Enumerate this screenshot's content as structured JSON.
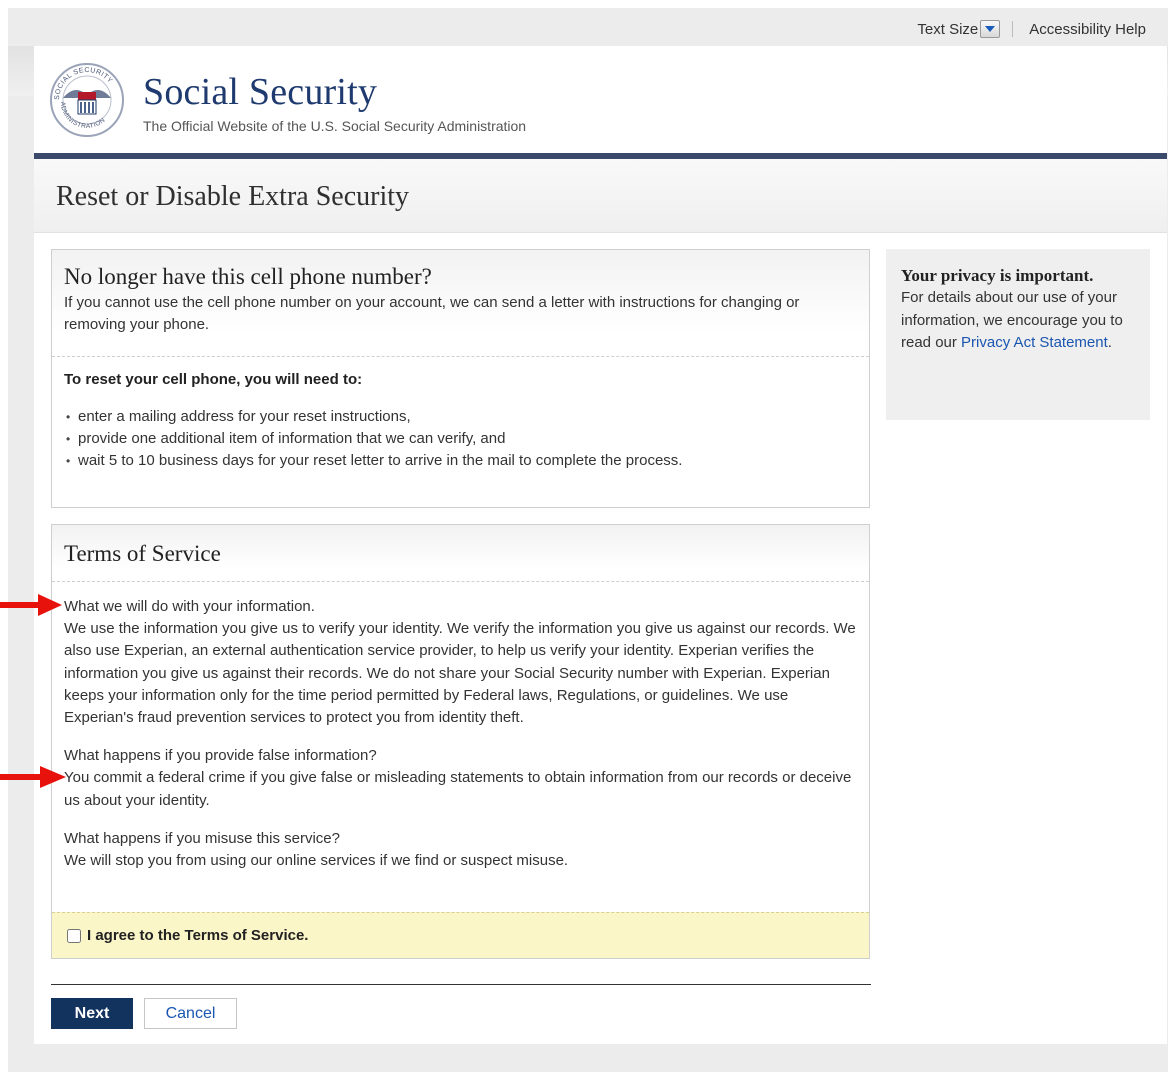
{
  "utility_bar": {
    "text_size_label": "Text Size",
    "accessibility_help": "Accessibility Help"
  },
  "header": {
    "site_name": "Social Security",
    "tagline": "The Official Website of the U.S. Social Security Administration",
    "seal_text": "SOCIAL SECURITY ADMINISTRATION USA"
  },
  "page_title": "Reset or Disable Extra Security",
  "phone_panel": {
    "heading": "No longer have this cell phone number?",
    "intro": "If you cannot use the cell phone number on your account, we can send a letter with instructions for changing or removing your phone.",
    "need_heading": "To reset your cell phone, you will need to:",
    "items": [
      "enter a mailing address for your reset instructions,",
      "provide one additional item of information that we can verify, and",
      "wait 5 to 10 business days for your reset letter to arrive in the mail to complete the process."
    ]
  },
  "terms_panel": {
    "heading": "Terms of Service",
    "sections": [
      {
        "title": "What we will do with your information.",
        "body": "We use the information you give us to verify your identity. We verify the information you give us against our records. We also use Experian, an external authentication service provider, to help us verify your identity. Experian verifies the information you give us against their records. We do not share your Social Security number with Experian. Experian keeps your information only for the time period permitted by Federal laws, Regulations, or guidelines. We use Experian's fraud prevention services to protect you from identity theft."
      },
      {
        "title": "What happens if you provide false information?",
        "body": "You commit a federal crime if you give false or misleading statements to obtain information from our records or deceive us about your identity."
      },
      {
        "title": "What happens if you misuse this service?",
        "body": "We will stop you from using our online services if we find or suspect misuse."
      }
    ],
    "agree_label": "I agree to the Terms of Service.",
    "agree_checked": false
  },
  "actions": {
    "next_label": "Next",
    "cancel_label": "Cancel"
  },
  "privacy_box": {
    "heading": "Your privacy is important.",
    "text": "For details about our use of your information, we encourage you to read our ",
    "link": "Privacy Act Statement",
    "after_link": "."
  },
  "colors": {
    "navy": "#13335f",
    "link": "#1a56b0",
    "annotation_arrow": "#e8120c",
    "agree_bg": "#fbf6c8"
  }
}
